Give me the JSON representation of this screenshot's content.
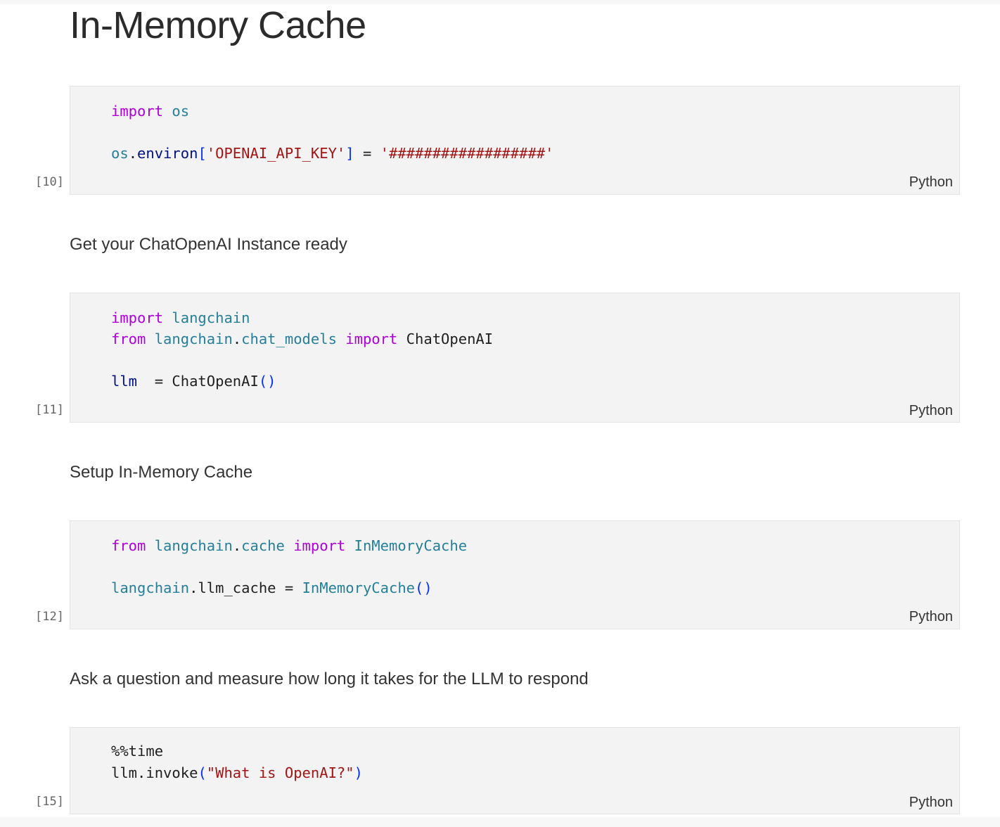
{
  "notebook": {
    "title": "In-Memory Cache",
    "cells": [
      {
        "execution_count": "[10]",
        "language": "Python",
        "code": {
          "line1": {
            "kw": "import",
            "mod": "os"
          },
          "line2": {
            "obj": "os",
            "dot": ".",
            "attr": "environ",
            "bracket_open": "[",
            "key": "'OPENAI_API_KEY'",
            "bracket_close": "]",
            "op": " = ",
            "value": "'##################'"
          }
        }
      },
      {
        "markdown": "Get your ChatOpenAI Instance ready"
      },
      {
        "execution_count": "[11]",
        "language": "Python",
        "code": {
          "line1": {
            "kw": "import",
            "mod": "langchain"
          },
          "line2": {
            "kw_from": "from",
            "mod_a": "langchain",
            "dot": ".",
            "mod_b": "chat_models",
            "kw_import": "import",
            "name": "ChatOpenAI"
          },
          "line3": {
            "var": "llm",
            "op": "  = ",
            "call": "ChatOpenAI",
            "parens": "()"
          }
        }
      },
      {
        "markdown": "Setup In-Memory Cache"
      },
      {
        "execution_count": "[12]",
        "language": "Python",
        "code": {
          "line1": {
            "kw_from": "from",
            "mod_a": "langchain",
            "dot": ".",
            "mod_b": "cache",
            "kw_import": "import",
            "name": "InMemoryCache"
          },
          "line2": {
            "mod": "langchain",
            "dot": ".",
            "attr": "llm_cache",
            "op": " = ",
            "call": "InMemoryCache",
            "parens": "()"
          }
        }
      },
      {
        "markdown": "Ask a question and measure how long it takes for the LLM to respond"
      },
      {
        "execution_count": "[15]",
        "language": "Python",
        "code": {
          "line1": {
            "magic": "%%time"
          },
          "line2": {
            "obj": "llm",
            "dot": ".",
            "method": "invoke",
            "paren_open": "(",
            "arg": "\"What is OpenAI?\"",
            "paren_close": ")"
          }
        }
      }
    ]
  },
  "colors": {
    "keyword": "#af00db",
    "module": "#267f99",
    "variable": "#001080",
    "string": "#a31515",
    "bracket": "#0431fa",
    "cell_background": "#f3f3f3"
  }
}
